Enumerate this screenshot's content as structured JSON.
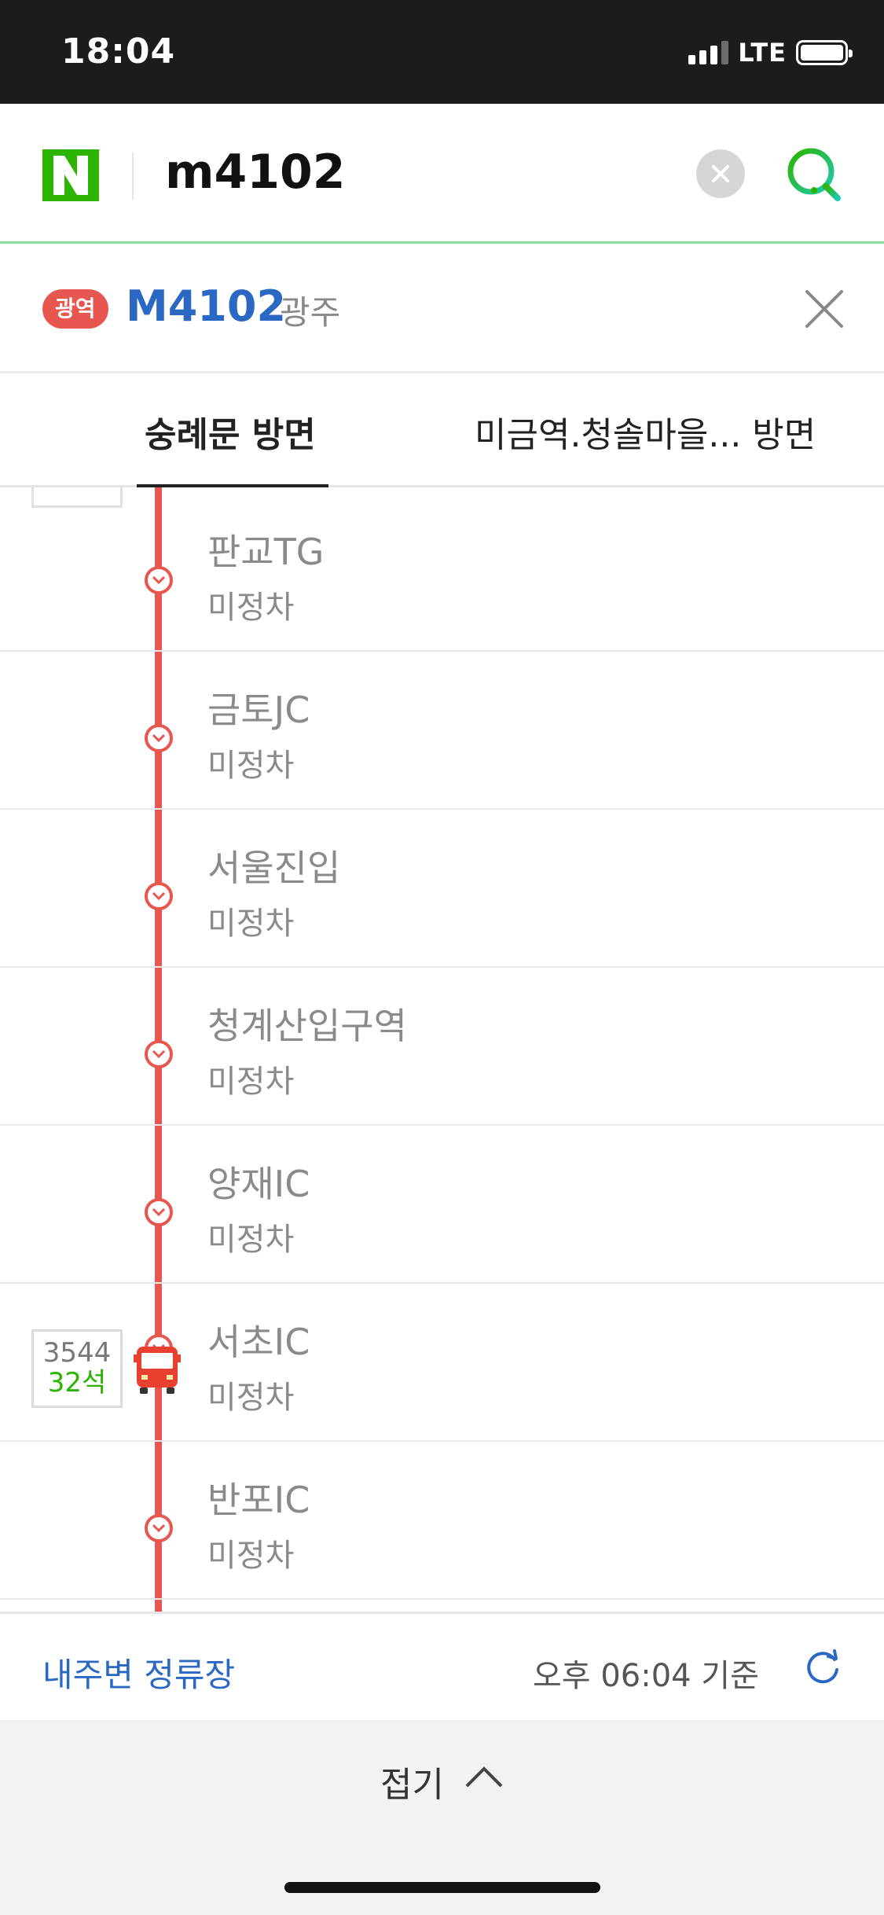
{
  "status_bar": {
    "time": "18:04",
    "network": "LTE"
  },
  "search": {
    "query": "m4102"
  },
  "route": {
    "badge": "광역",
    "number": "M4102",
    "region": "광주"
  },
  "tabs": [
    {
      "label": "숭례문 방면",
      "active": true
    },
    {
      "label": "미금역.청솔마을... 방면",
      "active": false
    }
  ],
  "stops": [
    {
      "name": "판교TG",
      "status": "미정차"
    },
    {
      "name": "금토JC",
      "status": "미정차"
    },
    {
      "name": "서울진입",
      "status": "미정차"
    },
    {
      "name": "청계산입구역",
      "status": "미정차"
    },
    {
      "name": "양재IC",
      "status": "미정차"
    },
    {
      "name": "서초IC",
      "status": "미정차"
    },
    {
      "name": "반포IC",
      "status": "미정차"
    }
  ],
  "bus": {
    "id": "3544",
    "seats": "32석"
  },
  "bottom": {
    "nearby_link": "내주변 정류장",
    "updated": "오후 06:04 기준",
    "collapse_label": "접기"
  },
  "colors": {
    "route_red": "#e8574f",
    "link_blue": "#2b68c4",
    "naver_green": "#2db400",
    "seat_green": "#2db400"
  }
}
